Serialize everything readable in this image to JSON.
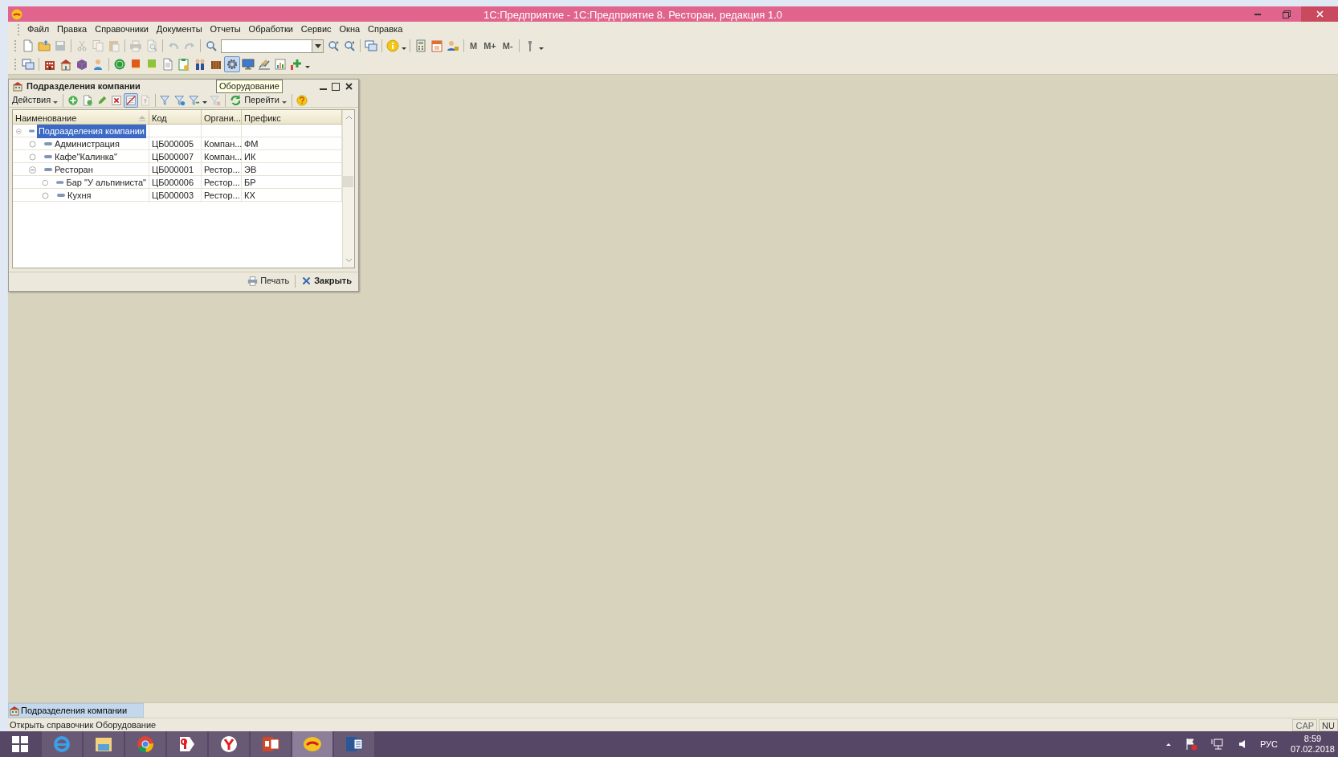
{
  "window": {
    "title": "1С:Предприятие - 1С:Предприятие 8. Ресторан, редакция 1.0"
  },
  "menu": [
    "Файл",
    "Правка",
    "Справочники",
    "Документы",
    "Отчеты",
    "Обработки",
    "Сервис",
    "Окна",
    "Справка"
  ],
  "toolbars": [
    {
      "items": [
        {
          "kind": "doc",
          "pressed": false,
          "disabled": false
        },
        {
          "kind": "folder",
          "pressed": false,
          "disabled": false
        },
        {
          "kind": "disk",
          "pressed": false,
          "disabled": true
        },
        {
          "kind": "separator"
        },
        {
          "kind": "scissors",
          "pressed": false,
          "disabled": true
        },
        {
          "kind": "copy",
          "pressed": false,
          "disabled": true
        },
        {
          "kind": "paste",
          "pressed": false,
          "disabled": true
        },
        {
          "kind": "separator"
        },
        {
          "kind": "printer",
          "pressed": false,
          "disabled": true
        },
        {
          "kind": "preview",
          "pressed": false,
          "disabled": true
        },
        {
          "kind": "separator"
        },
        {
          "kind": "undo",
          "pressed": false,
          "disabled": true
        },
        {
          "kind": "redo",
          "pressed": false,
          "disabled": true
        },
        {
          "kind": "separator"
        },
        {
          "kind": "search",
          "pressed": false,
          "disabled": false
        },
        {
          "kind": "combo"
        },
        {
          "kind": "findnext",
          "pressed": false,
          "disabled": false
        },
        {
          "kind": "findprev",
          "pressed": false,
          "disabled": false
        },
        {
          "kind": "separator"
        },
        {
          "kind": "windows",
          "pressed": false,
          "disabled": false
        },
        {
          "kind": "separator"
        },
        {
          "kind": "info",
          "pressed": false,
          "disabled": false
        },
        {
          "kind": "caret"
        },
        {
          "kind": "separator"
        },
        {
          "kind": "calculator",
          "pressed": false,
          "disabled": false
        },
        {
          "kind": "calendar",
          "pressed": false,
          "disabled": false
        },
        {
          "kind": "userlock",
          "pressed": false,
          "disabled": false
        },
        {
          "kind": "separator"
        },
        {
          "kind": "text",
          "label": "M"
        },
        {
          "kind": "text",
          "label": "M+"
        },
        {
          "kind": "text",
          "label": "M-"
        },
        {
          "kind": "separator"
        },
        {
          "kind": "tools",
          "pressed": false,
          "disabled": false
        },
        {
          "kind": "caret"
        }
      ]
    },
    {
      "items": [
        {
          "kind": "windows",
          "pressed": false,
          "disabled": false
        },
        {
          "kind": "separator"
        },
        {
          "kind": "building",
          "pressed": false,
          "disabled": false
        },
        {
          "kind": "house",
          "pressed": false,
          "disabled": false
        },
        {
          "kind": "box",
          "pressed": false,
          "disabled": false
        },
        {
          "kind": "person",
          "pressed": false,
          "disabled": false
        },
        {
          "kind": "separator"
        },
        {
          "kind": "coin",
          "pressed": false,
          "disabled": false
        },
        {
          "kind": "book",
          "pressed": false,
          "disabled": false
        },
        {
          "kind": "book2",
          "pressed": false,
          "disabled": false
        },
        {
          "kind": "page",
          "pressed": false,
          "disabled": false
        },
        {
          "kind": "clipdoc",
          "pressed": false,
          "disabled": false
        },
        {
          "kind": "people",
          "pressed": false,
          "disabled": false
        },
        {
          "kind": "crate",
          "pressed": false,
          "disabled": false
        },
        {
          "kind": "gear",
          "pressed": true,
          "disabled": false
        },
        {
          "kind": "monitor",
          "pressed": false,
          "disabled": false
        },
        {
          "kind": "pen",
          "pressed": false,
          "disabled": false
        },
        {
          "kind": "report",
          "pressed": false,
          "disabled": false
        },
        {
          "kind": "plus",
          "pressed": false,
          "disabled": false
        },
        {
          "kind": "caret"
        }
      ]
    }
  ],
  "subwindow": {
    "title": "Подразделения компании",
    "toolbar": [
      {
        "kind": "menu",
        "label": "Действия"
      },
      {
        "kind": "separator"
      },
      {
        "kind": "add",
        "pressed": false,
        "disabled": false
      },
      {
        "kind": "copyadd",
        "pressed": false,
        "disabled": false
      },
      {
        "kind": "edit",
        "pressed": false,
        "disabled": false
      },
      {
        "kind": "del",
        "pressed": false,
        "disabled": false
      },
      {
        "kind": "slash",
        "pressed": true,
        "disabled": false
      },
      {
        "kind": "up",
        "pressed": false,
        "disabled": true
      },
      {
        "kind": "separator"
      },
      {
        "kind": "filter",
        "pressed": false,
        "disabled": false
      },
      {
        "kind": "filter2",
        "pressed": false,
        "disabled": false
      },
      {
        "kind": "filter3",
        "pressed": false,
        "disabled": false
      },
      {
        "kind": "caret"
      },
      {
        "kind": "filterclear",
        "pressed": false,
        "disabled": true
      },
      {
        "kind": "separator"
      },
      {
        "kind": "refresh",
        "pressed": false,
        "disabled": false
      },
      {
        "kind": "menu",
        "label": "Перейти"
      },
      {
        "kind": "separator"
      },
      {
        "kind": "help",
        "pressed": false,
        "disabled": false
      }
    ],
    "tooltip": "Оборудование",
    "table": {
      "columns": [
        {
          "label": "Наименование",
          "sorted": true
        },
        {
          "label": "Код",
          "sorted": false
        },
        {
          "label": "Органи...",
          "sorted": false
        },
        {
          "label": "Префикс",
          "sorted": false
        }
      ],
      "rows": [
        {
          "kind": "group",
          "expanded": true,
          "selected": true,
          "name": "Подразделения компании",
          "children": [
            {
              "kind": "item",
              "selected": false,
              "name": "Администрация",
              "code": "ЦБ000005",
              "org": "Компан...",
              "prefix": "ФМ"
            },
            {
              "kind": "item",
              "selected": false,
              "name": "Кафе\"Калинка\"",
              "code": "ЦБ000007",
              "org": "Компан...",
              "prefix": "ИК"
            },
            {
              "kind": "group",
              "expanded": true,
              "selected": false,
              "name": "Ресторан",
              "code": "ЦБ000001",
              "org": "Рестор...",
              "prefix": "ЭВ",
              "children": [
                {
                  "kind": "item",
                  "selected": false,
                  "name": "Бар \"У альпиниста\"",
                  "code": "ЦБ000006",
                  "org": "Рестор...",
                  "prefix": "БР"
                },
                {
                  "kind": "item",
                  "selected": false,
                  "name": "Кухня",
                  "code": "ЦБ000003",
                  "org": "Рестор...",
                  "prefix": "КХ"
                }
              ]
            }
          ]
        }
      ]
    },
    "footer": [
      {
        "kind": "print",
        "label": "Печать"
      },
      {
        "kind": "close",
        "label": "Закрыть"
      }
    ]
  },
  "window_tabs": [
    {
      "label": "Подразделения компании",
      "selected": true
    }
  ],
  "status_bar": {
    "text": "Открыть справочник Оборудование",
    "indicators": [
      "CAP",
      "NU"
    ]
  },
  "taskbar": {
    "apps": [
      {
        "kind": "ie",
        "selected": false
      },
      {
        "kind": "explorer",
        "selected": false
      },
      {
        "kind": "chrome",
        "selected": false
      },
      {
        "kind": "yandex",
        "selected": false
      },
      {
        "kind": "ybrowser",
        "selected": false
      },
      {
        "kind": "powerpoint",
        "selected": false
      },
      {
        "kind": "onec",
        "selected": true
      },
      {
        "kind": "word",
        "selected": false
      }
    ],
    "language": "РУС",
    "time": "8:59",
    "date": "07.02.2018"
  }
}
